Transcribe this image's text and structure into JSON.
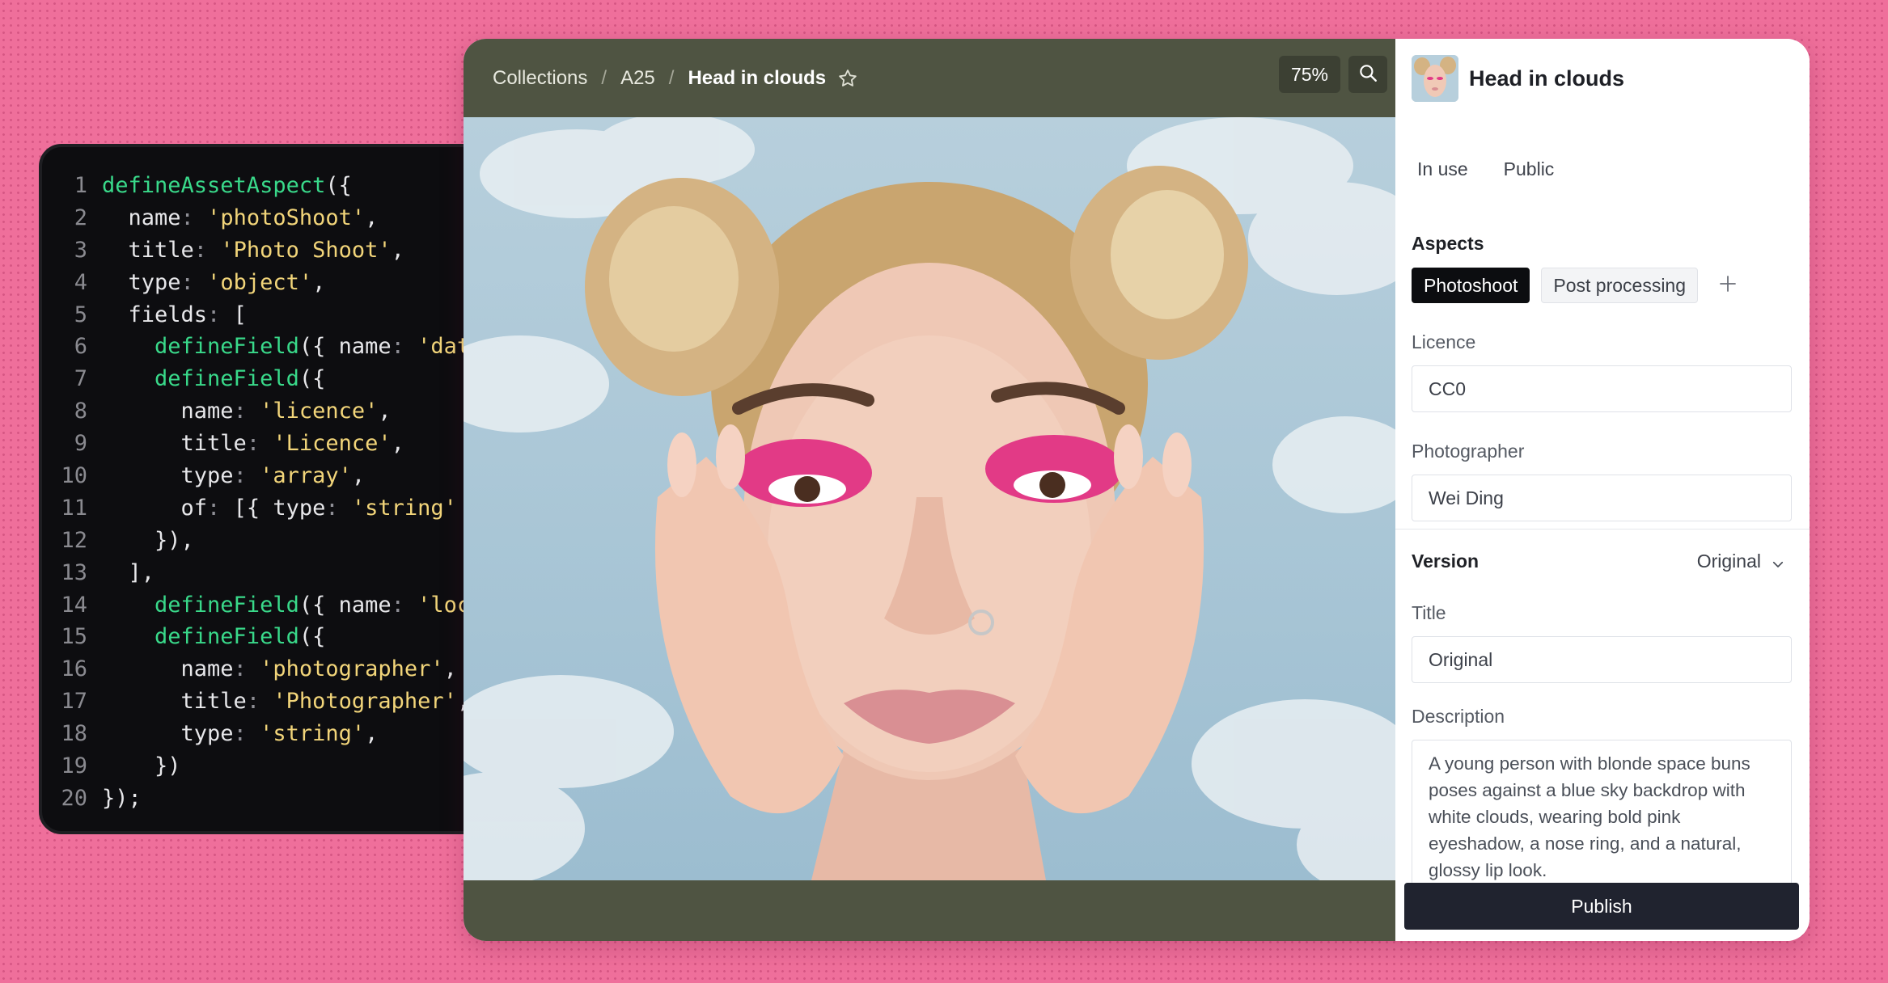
{
  "code": {
    "lines": [
      {
        "n": "1",
        "tokens": [
          {
            "t": "defineAssetAspect",
            "c": "t-fn"
          },
          {
            "t": "({",
            "c": "t-pun"
          }
        ]
      },
      {
        "n": "2",
        "tokens": [
          {
            "t": "  name",
            "c": "t-key"
          },
          {
            "t": ": ",
            "c": "t-col"
          },
          {
            "t": "'photoShoot'",
            "c": "t-str"
          },
          {
            "t": ",",
            "c": "t-pun"
          }
        ]
      },
      {
        "n": "3",
        "tokens": [
          {
            "t": "  title",
            "c": "t-key"
          },
          {
            "t": ": ",
            "c": "t-col"
          },
          {
            "t": "'Photo Shoot'",
            "c": "t-str"
          },
          {
            "t": ",",
            "c": "t-pun"
          }
        ]
      },
      {
        "n": "4",
        "tokens": [
          {
            "t": "  type",
            "c": "t-key"
          },
          {
            "t": ": ",
            "c": "t-col"
          },
          {
            "t": "'object'",
            "c": "t-str"
          },
          {
            "t": ",",
            "c": "t-pun"
          }
        ]
      },
      {
        "n": "5",
        "tokens": [
          {
            "t": "  fields",
            "c": "t-key"
          },
          {
            "t": ": ",
            "c": "t-col"
          },
          {
            "t": "[",
            "c": "t-pun"
          }
        ]
      },
      {
        "n": "6",
        "tokens": [
          {
            "t": "    defineField",
            "c": "t-fn"
          },
          {
            "t": "({ ",
            "c": "t-pun"
          },
          {
            "t": "name",
            "c": "t-key"
          },
          {
            "t": ": ",
            "c": "t-col"
          },
          {
            "t": "'date",
            "c": "t-str"
          }
        ]
      },
      {
        "n": "7",
        "tokens": [
          {
            "t": "    defineField",
            "c": "t-fn"
          },
          {
            "t": "({",
            "c": "t-pun"
          }
        ]
      },
      {
        "n": "8",
        "tokens": [
          {
            "t": "      name",
            "c": "t-key"
          },
          {
            "t": ": ",
            "c": "t-col"
          },
          {
            "t": "'licence'",
            "c": "t-str"
          },
          {
            "t": ",",
            "c": "t-pun"
          }
        ]
      },
      {
        "n": "9",
        "tokens": [
          {
            "t": "      title",
            "c": "t-key"
          },
          {
            "t": ": ",
            "c": "t-col"
          },
          {
            "t": "'Licence'",
            "c": "t-str"
          },
          {
            "t": ",",
            "c": "t-pun"
          }
        ]
      },
      {
        "n": "10",
        "tokens": [
          {
            "t": "      type",
            "c": "t-key"
          },
          {
            "t": ": ",
            "c": "t-col"
          },
          {
            "t": "'array'",
            "c": "t-str"
          },
          {
            "t": ",",
            "c": "t-pun"
          }
        ]
      },
      {
        "n": "11",
        "tokens": [
          {
            "t": "      of",
            "c": "t-key"
          },
          {
            "t": ": ",
            "c": "t-col"
          },
          {
            "t": "[{ ",
            "c": "t-pun"
          },
          {
            "t": "type",
            "c": "t-key"
          },
          {
            "t": ": ",
            "c": "t-col"
          },
          {
            "t": "'string'",
            "c": "t-str"
          },
          {
            "t": " }",
            "c": "t-pun"
          }
        ]
      },
      {
        "n": "12",
        "tokens": [
          {
            "t": "    }),",
            "c": "t-pun"
          }
        ]
      },
      {
        "n": "13",
        "tokens": [
          {
            "t": "  ],",
            "c": "t-pun"
          }
        ]
      },
      {
        "n": "14",
        "tokens": [
          {
            "t": "    defineField",
            "c": "t-fn"
          },
          {
            "t": "({ ",
            "c": "t-pun"
          },
          {
            "t": "name",
            "c": "t-key"
          },
          {
            "t": ": ",
            "c": "t-col"
          },
          {
            "t": "'loca",
            "c": "t-str"
          }
        ]
      },
      {
        "n": "15",
        "tokens": [
          {
            "t": "    defineField",
            "c": "t-fn"
          },
          {
            "t": "({",
            "c": "t-pun"
          }
        ]
      },
      {
        "n": "16",
        "tokens": [
          {
            "t": "      name",
            "c": "t-key"
          },
          {
            "t": ": ",
            "c": "t-col"
          },
          {
            "t": "'photographer'",
            "c": "t-str"
          },
          {
            "t": ",",
            "c": "t-pun"
          }
        ]
      },
      {
        "n": "17",
        "tokens": [
          {
            "t": "      title",
            "c": "t-key"
          },
          {
            "t": ": ",
            "c": "t-col"
          },
          {
            "t": "'Photographer'",
            "c": "t-str"
          },
          {
            "t": ",",
            "c": "t-pun"
          }
        ]
      },
      {
        "n": "18",
        "tokens": [
          {
            "t": "      type",
            "c": "t-key"
          },
          {
            "t": ": ",
            "c": "t-col"
          },
          {
            "t": "'string'",
            "c": "t-str"
          },
          {
            "t": ",",
            "c": "t-pun"
          }
        ]
      },
      {
        "n": "19",
        "tokens": [
          {
            "t": "    })",
            "c": "t-pun"
          }
        ]
      },
      {
        "n": "20",
        "tokens": [
          {
            "t": "});",
            "c": "t-pun"
          }
        ]
      }
    ]
  },
  "viewer": {
    "breadcrumb": {
      "items": [
        "Collections",
        "A25"
      ],
      "separator": "/",
      "current": "Head in clouds"
    },
    "zoom": "75%",
    "star_icon": "star-outline-icon",
    "search_icon": "search-icon"
  },
  "panel": {
    "title": "Head in clouds",
    "status": "In use",
    "visibility": "Public",
    "aspects_label": "Aspects",
    "aspect_tabs": [
      {
        "label": "Photoshoot",
        "active": true
      },
      {
        "label": "Post processing",
        "active": false
      }
    ],
    "add_icon": "plus-icon",
    "licence_label": "Licence",
    "licence_value": "CC0",
    "photographer_label": "Photographer",
    "photographer_value": "Wei Ding",
    "version_label": "Version",
    "version_value": "Original",
    "title_label": "Title",
    "title_value": "Original",
    "description_label": "Description",
    "description_value": "A young person with blonde space buns poses against a blue sky backdrop with white clouds, wearing bold pink eyeshadow, a nose ring, and a natural, glossy lip look.",
    "publish_label": "Publish"
  },
  "colors": {
    "background": "#ef6f9b",
    "viewer_bg": "#4f5442",
    "code_bg": "#0d0d10",
    "code_function": "#39d98a",
    "code_string": "#f2d57a",
    "publish_bg": "#20232f",
    "chip_active_bg": "#0c0d10"
  }
}
